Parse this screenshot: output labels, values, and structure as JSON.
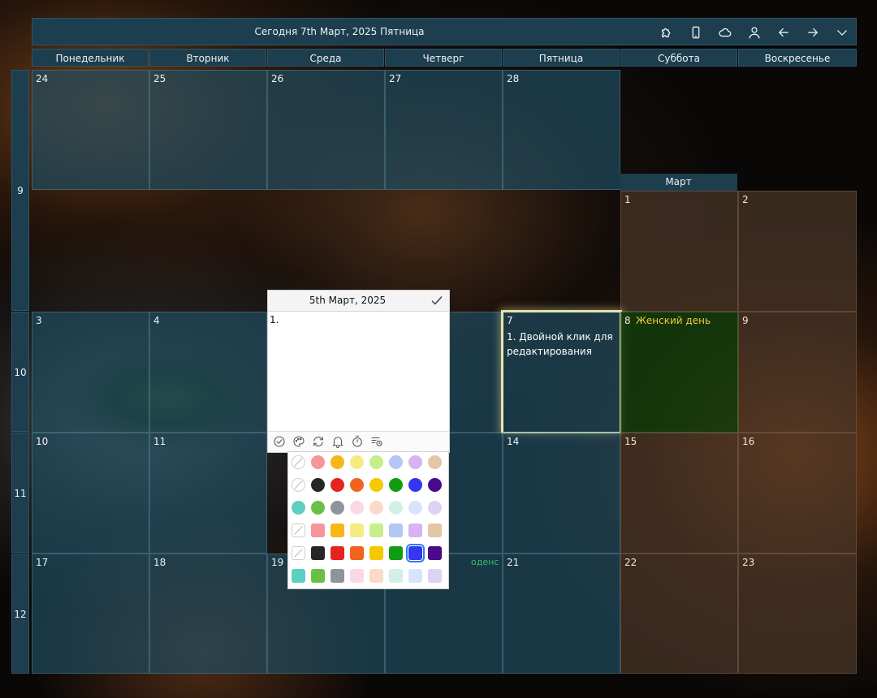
{
  "header": {
    "title": "Сегодня 7th Март, 2025 Пятница",
    "icons": [
      "puzzle-icon",
      "phone-icon",
      "cloud-icon",
      "user-icon",
      "arrow-left-icon",
      "arrow-right-icon",
      "chevron-down-icon"
    ]
  },
  "weekdays": [
    "Понедельник",
    "Вторник",
    "Среда",
    "Четверг",
    "Пятница",
    "Суббота",
    "Воскресенье"
  ],
  "weeks": [
    "9",
    "10",
    "11",
    "12"
  ],
  "month_label": "Март",
  "cells": {
    "feb24": "24",
    "feb25": "25",
    "feb26": "26",
    "feb27": "27",
    "feb28": "28",
    "mar1": "1",
    "mar2": "2",
    "mar3": "3",
    "mar4": "4",
    "mar7": "7",
    "mar8": "8",
    "mar9": "9",
    "mar10": "10",
    "mar11": "11",
    "mar14": "14",
    "mar15": "15",
    "mar16": "16",
    "mar17": "17",
    "mar18": "18",
    "mar19": "19",
    "mar21": "21",
    "mar22": "22",
    "mar23": "23"
  },
  "events": {
    "mar7_note": "1. Двойной клик для редактирования",
    "mar8_holiday": "Женский день",
    "mar20_fragment": "оденс"
  },
  "editor": {
    "date": "5th Март, 2025",
    "text": "1."
  },
  "colors": {
    "accent_header": "#1d3e4e",
    "today_glow": "#e6e2b0",
    "holiday_text": "#f0c840",
    "palette_circles": [
      "none",
      "#f4969a",
      "#f8b619",
      "#f6eb80",
      "#c6ef8a",
      "#b2c7f4",
      "#d7b3f3",
      "#e4c5a5",
      "none",
      "#262626",
      "#e52420",
      "#f3631f",
      "#f5c800",
      "#119c14",
      "#3337f0",
      "#4a0a8b",
      "#5ccfbe",
      "#6abf46",
      "#8f939c",
      "#fbd8e6",
      "#fbdac8",
      "#d2f0e6",
      "#d8e4fb",
      "#ddd2f4"
    ],
    "palette_squares": [
      "none",
      "#f4969a",
      "#f8b619",
      "#f6eb80",
      "#c6ef8a",
      "#b2c7f4",
      "#d7b3f3",
      "#e4c5a5",
      "none",
      "#262626",
      "#e52420",
      "#f3631f",
      "#f5c800",
      "#119c14",
      "#3337f0",
      "#4a0a8b",
      "#5ccfbe",
      "#6abf46",
      "#8f939c",
      "#fbd8e6",
      "#fbdac8",
      "#d2f0e6",
      "#d8e4fb",
      "#ddd2f4"
    ]
  }
}
